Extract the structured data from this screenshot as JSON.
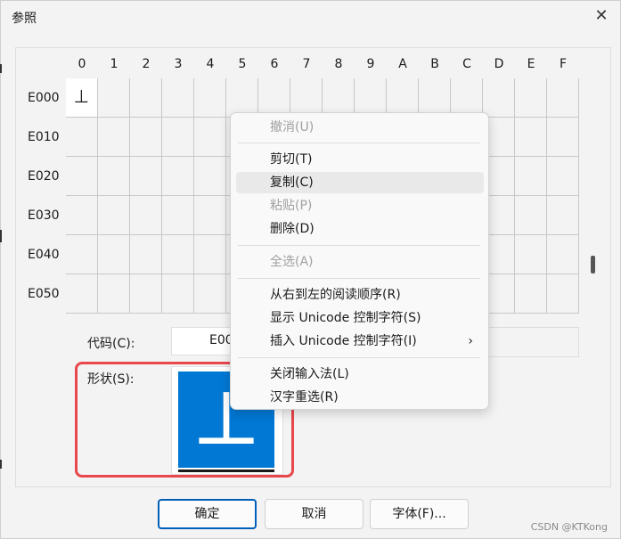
{
  "window": {
    "title": "参照",
    "close_glyph": "✕"
  },
  "grid": {
    "columns": [
      "0",
      "1",
      "2",
      "3",
      "4",
      "5",
      "6",
      "7",
      "8",
      "9",
      "A",
      "B",
      "C",
      "D",
      "E",
      "F"
    ],
    "rows": [
      "E000",
      "E010",
      "E020",
      "E030",
      "E040",
      "E050"
    ],
    "selected_char": "⊥"
  },
  "fields": {
    "code_label": "代码(C):",
    "code_value": "E00",
    "shape_label": "形状(S):",
    "shape_glyph": "⊥"
  },
  "context_menu": {
    "items": [
      {
        "label": "撤消(U)",
        "disabled": true
      },
      {
        "label": "剪切(T)",
        "disabled": false
      },
      {
        "label": "复制(C)",
        "disabled": false,
        "highlighted": true
      },
      {
        "label": "粘贴(P)",
        "disabled": true
      },
      {
        "label": "删除(D)",
        "disabled": false
      },
      {
        "label": "全选(A)",
        "disabled": true
      },
      {
        "label": "从右到左的阅读顺序(R)",
        "disabled": false
      },
      {
        "label": "显示 Unicode 控制字符(S)",
        "disabled": false
      },
      {
        "label": "插入 Unicode 控制字符(I)",
        "disabled": false,
        "submenu_glyph": "›"
      },
      {
        "label": "关闭输入法(L)",
        "disabled": false
      },
      {
        "label": "汉字重选(R)",
        "disabled": false
      }
    ]
  },
  "buttons": {
    "ok": "确定",
    "cancel": "取消",
    "font": "字体(F)..."
  },
  "watermark": "CSDN @KTKong",
  "colors": {
    "accent": "#0078d4",
    "highlight_border": "#e8474b"
  }
}
